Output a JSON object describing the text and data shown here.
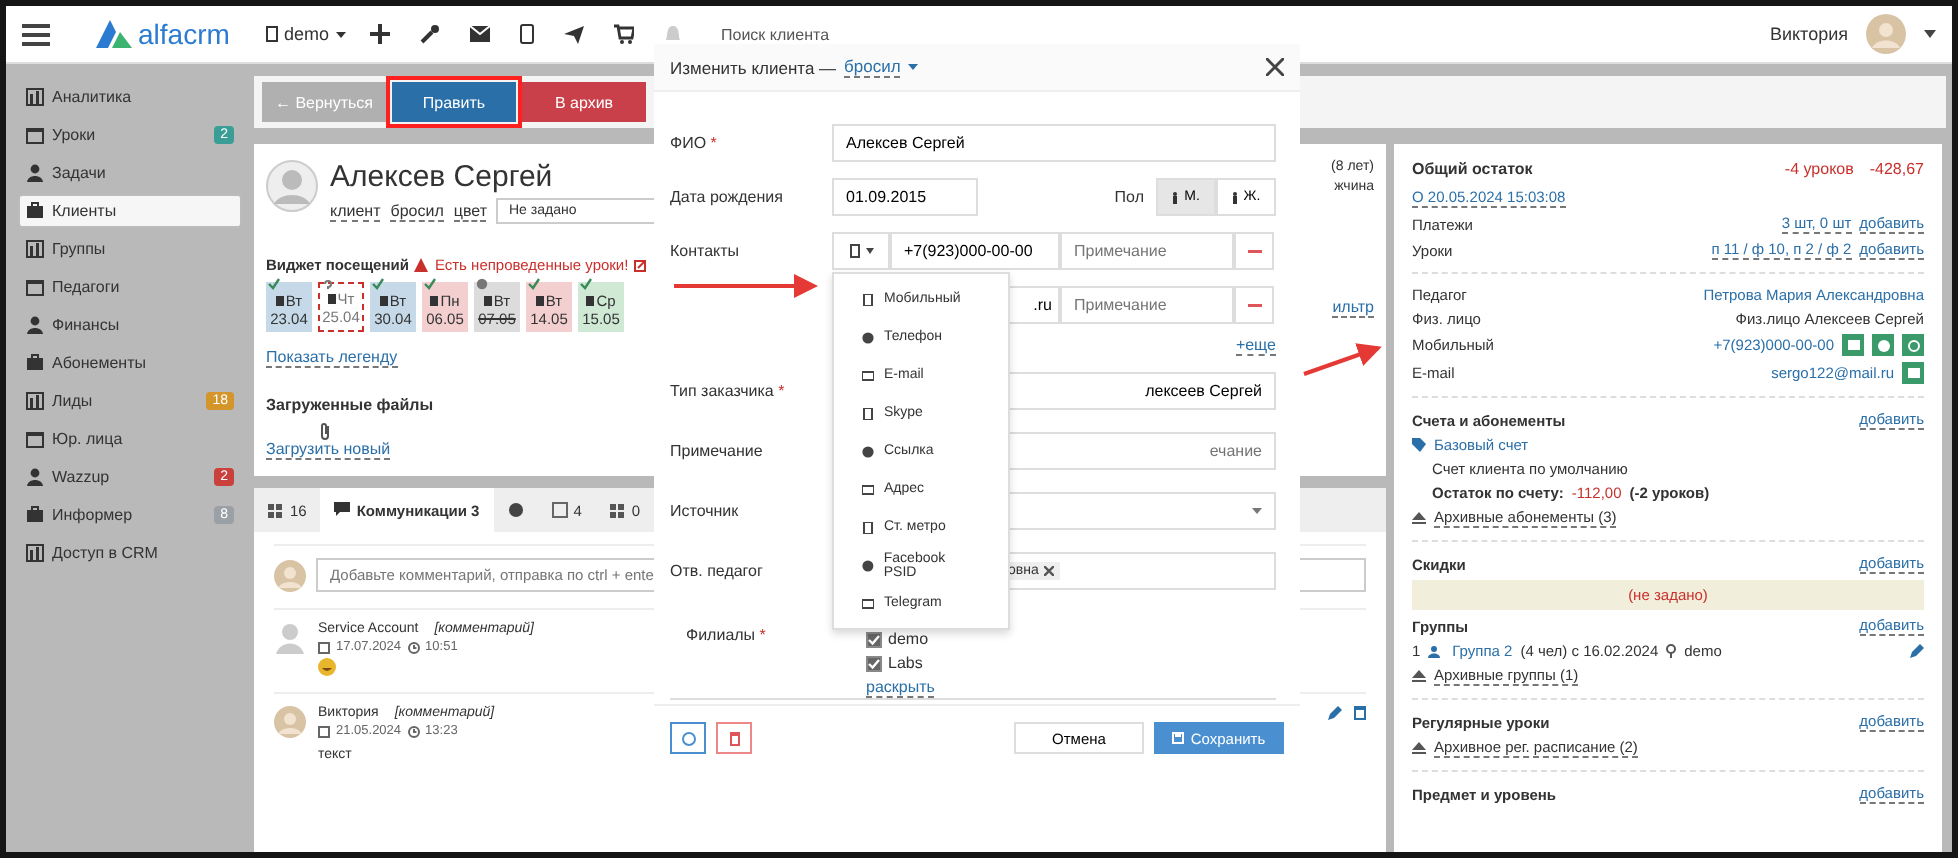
{
  "header": {
    "logo": "alfacrm",
    "branch": "demo",
    "search": {
      "placeholder": "Поиск клиента"
    },
    "user": "Виктория"
  },
  "sidebar": {
    "items": [
      {
        "label": "Аналитика",
        "selected": false
      },
      {
        "label": "Уроки",
        "selected": false,
        "badge": "2",
        "color": "#3a9e96"
      },
      {
        "label": "Задачи",
        "selected": false
      },
      {
        "label": "Клиенты",
        "selected": true
      },
      {
        "label": "Группы",
        "selected": false
      },
      {
        "label": "Педагоги",
        "selected": false
      },
      {
        "label": "Финансы",
        "selected": false
      },
      {
        "label": "Абонементы",
        "selected": false
      },
      {
        "label": "Лиды",
        "selected": false,
        "badge": "18",
        "color": "#d4952b"
      },
      {
        "label": "Юр. лица",
        "selected": false
      },
      {
        "label": "Wazzup",
        "selected": false,
        "badge": "2",
        "color": "#c9403c"
      },
      {
        "label": "Информер",
        "selected": false,
        "badge": "8",
        "color": "#9aa0a6"
      },
      {
        "label": "Доступ в CRM",
        "selected": false
      }
    ]
  },
  "toolbar": {
    "buttons": [
      {
        "label": "← Вернуться",
        "kind": "back",
        "highlighted": false
      },
      {
        "label": "Править",
        "kind": "edit",
        "highlighted": true
      },
      {
        "label": "В архив",
        "kind": "archive",
        "highlighted": false
      }
    ]
  },
  "client": {
    "name": "Алексев Сергей",
    "tags": [
      "клиент",
      "бросил",
      "цвет"
    ],
    "color_select": "Не задано",
    "age": "(8 лет)",
    "gender_partial": "жчина",
    "widget": {
      "title": "Виджет посещений",
      "warning": "Есть непроведенные уроки!",
      "filter_partial": "ильтр",
      "legend_link": "Показать легенду",
      "days": [
        {
          "weekday": "Вт",
          "date": "23.04",
          "kind": "check",
          "color": "#c5d9e8"
        },
        {
          "weekday": "Чт",
          "date": "25.04",
          "kind": "question",
          "color": "#ffffff"
        },
        {
          "weekday": "Вт",
          "date": "30.04",
          "kind": "check",
          "color": "#c5d9e8"
        },
        {
          "weekday": "Пн",
          "date": "06.05",
          "kind": "check",
          "color": "#f3cfd0"
        },
        {
          "weekday": "Вт",
          "date": "07.05",
          "kind": "cancel",
          "color": "#dcdcdc"
        },
        {
          "weekday": "Вт",
          "date": "14.05",
          "kind": "check",
          "color": "#f3cfd0"
        },
        {
          "weekday": "Ср",
          "date": "15.05",
          "kind": "check",
          "color": "#cfe9d5"
        }
      ]
    },
    "files": {
      "title": "Загруженные файлы",
      "upload_link": "Загрузить новый"
    }
  },
  "tabs": [
    {
      "label": "16",
      "kind": "lessons",
      "selected": false
    },
    {
      "label": "Коммуникации 3",
      "kind": "chat",
      "selected": true
    },
    {
      "kind": "whatsapp",
      "selected": false
    },
    {
      "label": "4",
      "kind": "tasks",
      "selected": false
    },
    {
      "label": "0",
      "kind": "stats",
      "selected": false
    }
  ],
  "comment_field": {
    "placeholder": "Добавьте комментарий, отправка по ctrl + ente"
  },
  "comments": [
    {
      "author": "Service Account",
      "type": "[комментарий]",
      "date": "17.07.2024",
      "time": "10:51",
      "kind": "emoji"
    },
    {
      "author": "Виктория",
      "type": "[комментарий]",
      "date": "21.05.2024",
      "time": "13:23",
      "kind": "text",
      "text": "текст"
    }
  ],
  "summary": {
    "title": "Общий остаток",
    "lessons": "-4 уроков",
    "amount": "-428,67",
    "date_link": "О 20.05.2024 15:03:08",
    "rows": [
      {
        "label": "Платежи",
        "value": "3 шт, 0 шт",
        "action": "добавить"
      },
      {
        "label": "Уроки",
        "value": "п 11 / ф 10, п 2 / ф 2",
        "action": "добавить"
      }
    ],
    "details": [
      {
        "label": "Педагог",
        "value": "Петрова Мария Александровна",
        "kind": "link"
      },
      {
        "label": "Физ. лицо",
        "value": "Физ.лицо Алексеев Сергей",
        "kind": "plain"
      },
      {
        "label": "Мобильный",
        "value": "+7(923)000-00-00",
        "kind": "phone"
      },
      {
        "label": "E-mail",
        "value": "sergo122@mail.ru",
        "kind": "email"
      }
    ]
  },
  "accounts": {
    "title": "Счета и абонементы",
    "action": "добавить",
    "account": "Базовый счет",
    "description": "Счет клиента по умолчанию",
    "balance_label": "Остаток по счету:",
    "balance_amount": "-112,00",
    "balance_lessons": "(-2 уроков)",
    "archive_link": "Архивные абонементы (3)"
  },
  "discounts": {
    "title": "Скидки",
    "action": "добавить",
    "empty": "(не задано)"
  },
  "groups": {
    "title": "Группы",
    "action": "добавить",
    "index": "1",
    "group_link": "Группа 2",
    "details": "(4 чел) с 16.02.2024",
    "branch": "demo",
    "archive_link": "Архивные группы (1)"
  },
  "regular": {
    "title": "Регулярные уроки",
    "action": "добавить",
    "archive_link": "Архивное рег. расписание (2)"
  },
  "subject": {
    "title": "Предмет и уровень",
    "action": "добавить"
  },
  "modal": {
    "title": "Изменить клиента —",
    "status": "бросил",
    "name_label": "ФИО",
    "name_required": "*",
    "name": "Алексев Сергей",
    "birth_label": "Дата рождения",
    "birth": "01.09.2015",
    "gender_label": "Пол",
    "genders": [
      {
        "label": "М.",
        "selected": true
      },
      {
        "label": "Ж.",
        "selected": false
      }
    ],
    "contacts_label": "Контакты",
    "contacts": [
      {
        "value": "+7(923)000-00-00",
        "note_placeholder": "Примечание"
      },
      {
        "value": ".ru",
        "note_placeholder": "Примечание"
      }
    ],
    "more_link": "+еще",
    "type_menu": {
      "open": true,
      "items": [
        "Мобильный",
        "Телефон",
        "E-mail",
        "Skype",
        "Ссылка",
        "Адрес",
        "Ст. метро",
        "Facebook PSID",
        "Telegram"
      ]
    },
    "customer_label": "Тип заказчика",
    "customer_required": "*",
    "customer": "лексеев Сергей",
    "note_label": "Примечание",
    "note_placeholder": "ечание",
    "source_label": "Источник",
    "teacher_label": "Отв. педагог",
    "teacher_tag": "овна",
    "branches_label": "Филиалы",
    "branches_required": "*",
    "branches": [
      {
        "label": "demo",
        "checked": true
      },
      {
        "label": "Labs",
        "checked": true
      }
    ],
    "expand_link": "раскрыть",
    "cancel": "Отмена",
    "save": "Сохранить"
  }
}
